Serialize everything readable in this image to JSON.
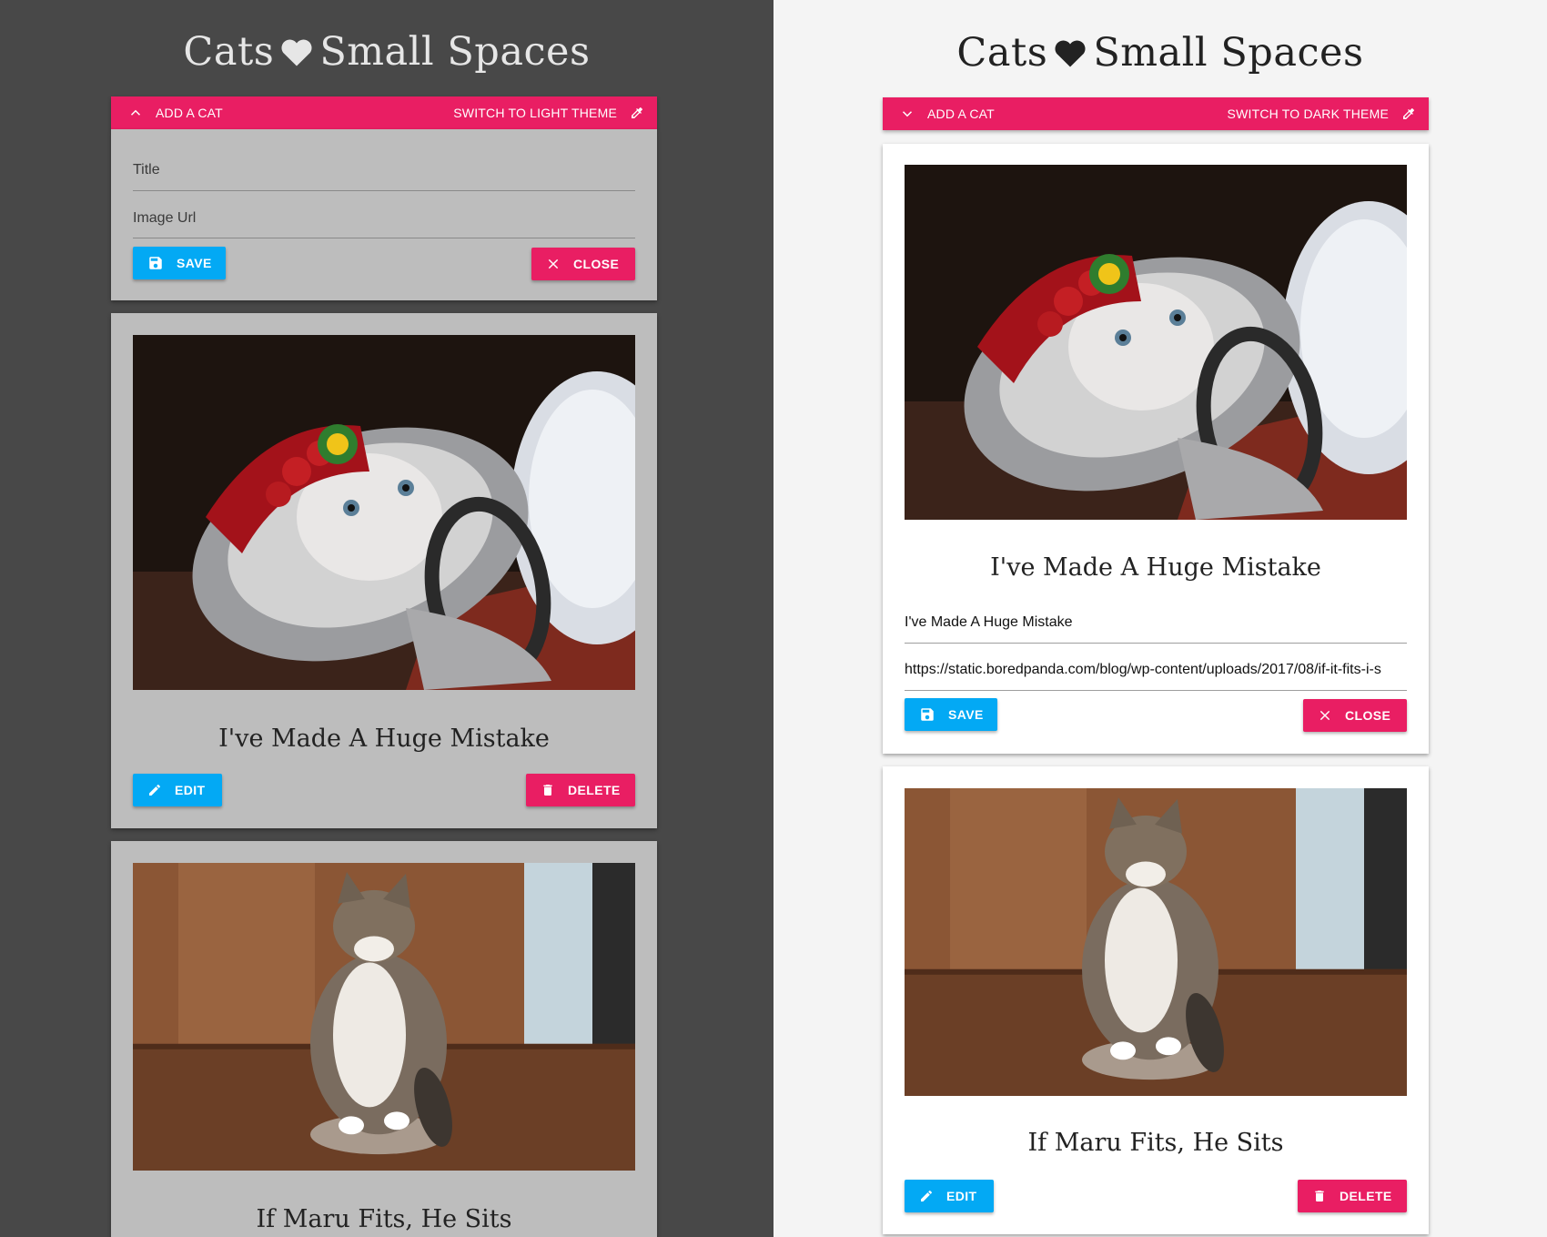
{
  "app": {
    "title_left": "Cats",
    "title_right": "Small Spaces"
  },
  "dark_panel": {
    "bar": {
      "add_label": "ADD A CAT",
      "theme_label": "SWITCH TO LIGHT THEME"
    },
    "form": {
      "title_placeholder": "Title",
      "url_placeholder": "Image Url",
      "save_label": "SAVE",
      "close_label": "CLOSE"
    },
    "cats": [
      {
        "title": "I've Made A Huge Mistake",
        "edit_label": "EDIT",
        "delete_label": "DELETE"
      },
      {
        "title": "If Maru Fits, He Sits"
      }
    ]
  },
  "light_panel": {
    "bar": {
      "add_label": "ADD A CAT",
      "theme_label": "SWITCH TO DARK THEME"
    },
    "cats": [
      {
        "title": "I've Made A Huge Mistake",
        "edit_title_value": "I've Made A Huge Mistake",
        "edit_url_value": "https://static.boredpanda.com/blog/wp-content/uploads/2017/08/if-it-fits-i-s",
        "save_label": "SAVE",
        "close_label": "CLOSE"
      },
      {
        "title": "If Maru Fits, He Sits",
        "edit_label": "EDIT",
        "delete_label": "DELETE"
      }
    ]
  },
  "colors": {
    "accent": "#e91e63",
    "primary": "#03a9f4",
    "dark_bg": "#484848",
    "light_bg": "#f4f4f4"
  }
}
